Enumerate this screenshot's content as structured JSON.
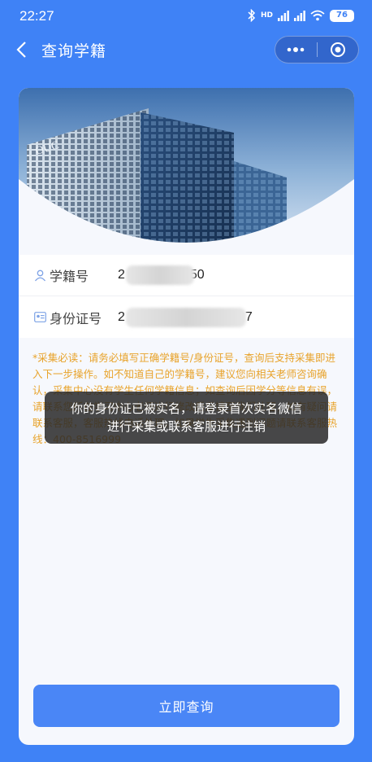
{
  "status_bar": {
    "time": "22:27",
    "signal_text": "HD",
    "battery": "76"
  },
  "nav": {
    "title": "查询学籍",
    "more_label": "•••"
  },
  "form": {
    "student_id": {
      "label": "学籍号",
      "value_start": "2",
      "value_end": "50"
    },
    "id_card": {
      "label": "身份证号",
      "value_start": "2",
      "value_end": "7"
    }
  },
  "notice": "*采集必读：请务必填写正确学籍号/身份证号，查询后支持采集即进入下一步操作。如不知道自己的学籍号，建议您向相关老师咨询确认，采集中心没有学生任何学籍信息；如查询后因学分等信息有误，请联系您所在学习中心老师进行修改后反馈至我们处理，如有疑问请联系客服，客服热线电话处理。如果学生采集遇到问题请联系客服热线：400-8516999",
  "toast": {
    "line1": "你的身份证已被实名，请登录首次实名微信",
    "line2": "进行采集或联系客服进行注销"
  },
  "submit_label": "立即查询",
  "banner": {
    "sign_text": "OUC"
  },
  "colors": {
    "primary": "#4a86f6",
    "background": "#3f82f6",
    "notice": "#e8a32b"
  }
}
